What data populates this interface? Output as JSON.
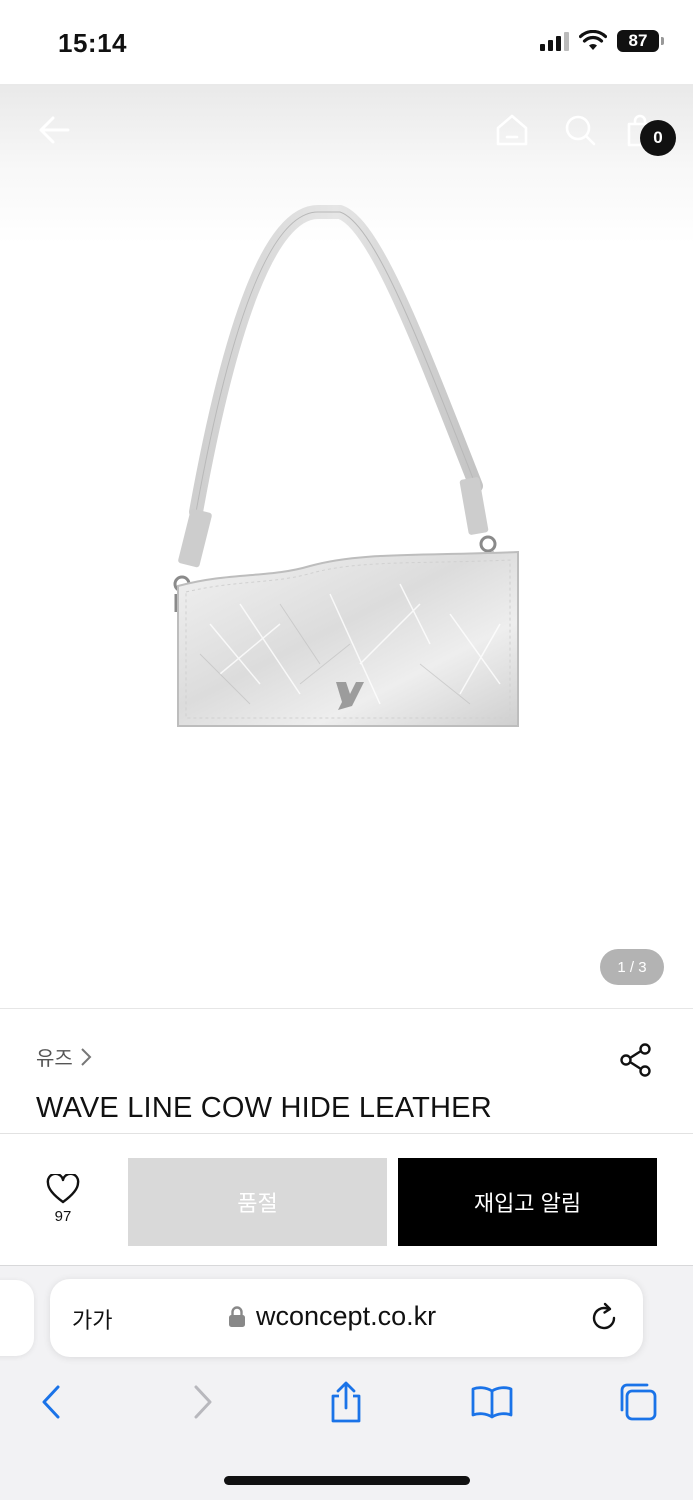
{
  "status_bar": {
    "time": "15:14",
    "battery": "87"
  },
  "header": {
    "cart_count": "0"
  },
  "gallery": {
    "counter": "1 / 3"
  },
  "product": {
    "brand": "유즈",
    "title": "WAVE LINE COW HIDE LEATHER"
  },
  "buy_bar": {
    "like_count": "97",
    "soldout_label": "품절",
    "restock_label": "재입고 알림"
  },
  "browser": {
    "aa_label": "가가",
    "url": "wconcept.co.kr"
  },
  "icons": {
    "back": "arrow-left-icon",
    "home": "home-icon",
    "search": "search-icon",
    "cart": "shopping-bag-icon",
    "share": "share-icon",
    "like": "heart-icon",
    "lock": "lock-icon",
    "reload": "reload-icon"
  },
  "colors": {
    "primary_button": "#000000",
    "disabled_button": "#d9d9d9",
    "safari_accent": "#1a73e8"
  }
}
